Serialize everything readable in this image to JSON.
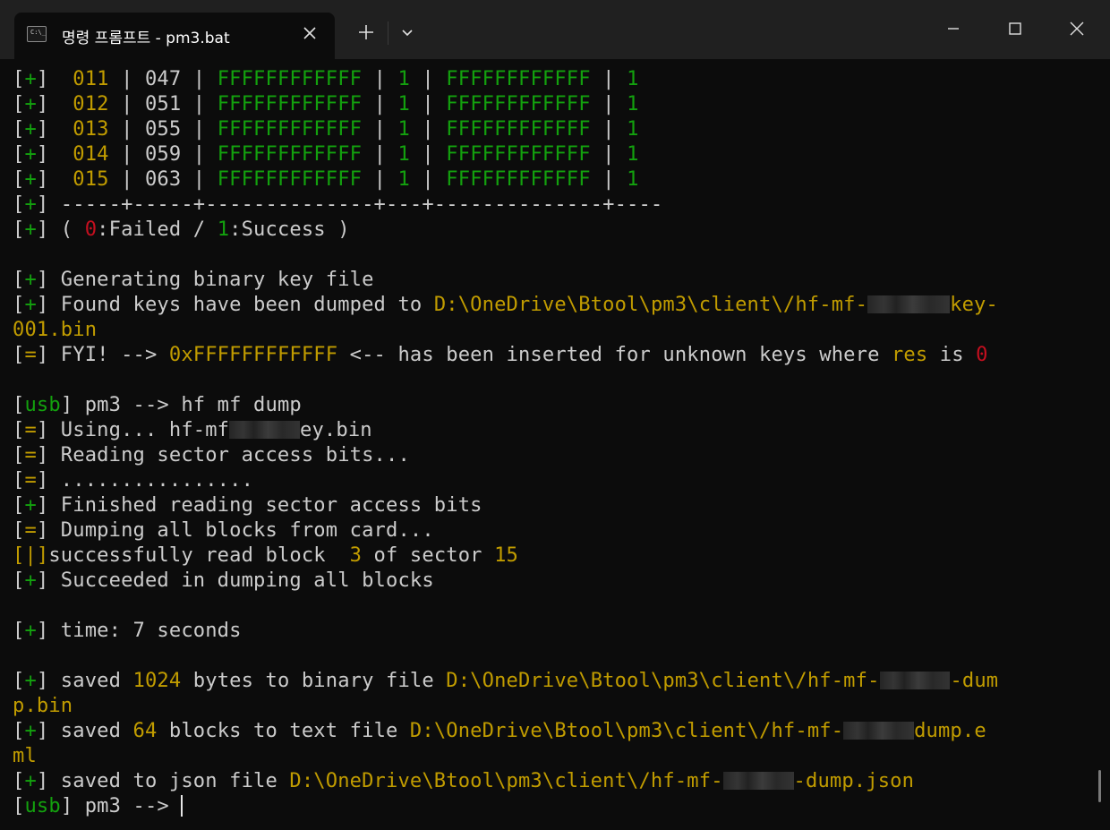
{
  "window": {
    "tab_title": "명령 프롬프트 - pm3.bat",
    "tab_icon_text": "C:\\_"
  },
  "terminal": {
    "lines": [
      [
        [
          "[",
          "w"
        ],
        [
          "+",
          "g"
        ],
        [
          "]  ",
          "w"
        ],
        [
          "011",
          "y"
        ],
        [
          " | 047 | ",
          "w"
        ],
        [
          "FFFFFFFFFFFF",
          "g"
        ],
        [
          " | ",
          "w"
        ],
        [
          "1",
          "g"
        ],
        [
          " | ",
          "w"
        ],
        [
          "FFFFFFFFFFFF",
          "g"
        ],
        [
          " | ",
          "w"
        ],
        [
          "1",
          "g"
        ]
      ],
      [
        [
          "[",
          "w"
        ],
        [
          "+",
          "g"
        ],
        [
          "]  ",
          "w"
        ],
        [
          "012",
          "y"
        ],
        [
          " | 051 | ",
          "w"
        ],
        [
          "FFFFFFFFFFFF",
          "g"
        ],
        [
          " | ",
          "w"
        ],
        [
          "1",
          "g"
        ],
        [
          " | ",
          "w"
        ],
        [
          "FFFFFFFFFFFF",
          "g"
        ],
        [
          " | ",
          "w"
        ],
        [
          "1",
          "g"
        ]
      ],
      [
        [
          "[",
          "w"
        ],
        [
          "+",
          "g"
        ],
        [
          "]  ",
          "w"
        ],
        [
          "013",
          "y"
        ],
        [
          " | 055 | ",
          "w"
        ],
        [
          "FFFFFFFFFFFF",
          "g"
        ],
        [
          " | ",
          "w"
        ],
        [
          "1",
          "g"
        ],
        [
          " | ",
          "w"
        ],
        [
          "FFFFFFFFFFFF",
          "g"
        ],
        [
          " | ",
          "w"
        ],
        [
          "1",
          "g"
        ]
      ],
      [
        [
          "[",
          "w"
        ],
        [
          "+",
          "g"
        ],
        [
          "]  ",
          "w"
        ],
        [
          "014",
          "y"
        ],
        [
          " | 059 | ",
          "w"
        ],
        [
          "FFFFFFFFFFFF",
          "g"
        ],
        [
          " | ",
          "w"
        ],
        [
          "1",
          "g"
        ],
        [
          " | ",
          "w"
        ],
        [
          "FFFFFFFFFFFF",
          "g"
        ],
        [
          " | ",
          "w"
        ],
        [
          "1",
          "g"
        ]
      ],
      [
        [
          "[",
          "w"
        ],
        [
          "+",
          "g"
        ],
        [
          "]  ",
          "w"
        ],
        [
          "015",
          "y"
        ],
        [
          " | 063 | ",
          "w"
        ],
        [
          "FFFFFFFFFFFF",
          "g"
        ],
        [
          " | ",
          "w"
        ],
        [
          "1",
          "g"
        ],
        [
          " | ",
          "w"
        ],
        [
          "FFFFFFFFFFFF",
          "g"
        ],
        [
          " | ",
          "w"
        ],
        [
          "1",
          "g"
        ]
      ],
      [
        [
          "[",
          "w"
        ],
        [
          "+",
          "g"
        ],
        [
          "] -----+-----+--------------+---+--------------+----",
          "w"
        ]
      ],
      [
        [
          "[",
          "w"
        ],
        [
          "+",
          "g"
        ],
        [
          "] ( ",
          "w"
        ],
        [
          "0",
          "r"
        ],
        [
          ":Failed / ",
          "w"
        ],
        [
          "1",
          "g"
        ],
        [
          ":Success )",
          "w"
        ]
      ],
      [],
      [
        [
          "[",
          "w"
        ],
        [
          "+",
          "g"
        ],
        [
          "] Generating binary key file",
          "w"
        ]
      ],
      [
        [
          "[",
          "w"
        ],
        [
          "+",
          "g"
        ],
        [
          "] Found keys have been dumped to ",
          "w"
        ],
        [
          "D:\\OneDrive\\Btool\\pm3\\client\\/hf-mf-",
          "y"
        ],
        [
          "blur:7",
          "b"
        ],
        [
          "key-",
          "y"
        ]
      ],
      [
        [
          "001.bin",
          "y"
        ]
      ],
      [
        [
          "[",
          "w"
        ],
        [
          "=",
          "y"
        ],
        [
          "] FYI! --> ",
          "w"
        ],
        [
          "0xFFFFFFFFFFFF",
          "y"
        ],
        [
          " <-- has been inserted for unknown keys where ",
          "w"
        ],
        [
          "res",
          "y"
        ],
        [
          " is ",
          "w"
        ],
        [
          "0",
          "r"
        ]
      ],
      [],
      [
        [
          "[",
          "w"
        ],
        [
          "usb",
          "g"
        ],
        [
          "] pm3 --> hf mf dump",
          "w"
        ]
      ],
      [
        [
          "[",
          "w"
        ],
        [
          "=",
          "y"
        ],
        [
          "] Using... hf-mf",
          "w"
        ],
        [
          "blur:6",
          "b"
        ],
        [
          "ey.bin",
          "w"
        ]
      ],
      [
        [
          "[",
          "w"
        ],
        [
          "=",
          "y"
        ],
        [
          "] Reading sector access bits...",
          "w"
        ]
      ],
      [
        [
          "[",
          "w"
        ],
        [
          "=",
          "y"
        ],
        [
          "] ................",
          "w"
        ]
      ],
      [
        [
          "[",
          "w"
        ],
        [
          "+",
          "g"
        ],
        [
          "] Finished reading sector access bits",
          "w"
        ]
      ],
      [
        [
          "[",
          "w"
        ],
        [
          "=",
          "y"
        ],
        [
          "] Dumping all blocks from card...",
          "w"
        ]
      ],
      [
        [
          "[|]",
          "y"
        ],
        [
          "successfully read block  ",
          "w"
        ],
        [
          "3",
          "y"
        ],
        [
          " of sector ",
          "w"
        ],
        [
          "15",
          "y"
        ]
      ],
      [
        [
          "[",
          "w"
        ],
        [
          "+",
          "g"
        ],
        [
          "] Succeeded in dumping all blocks",
          "w"
        ]
      ],
      [],
      [
        [
          "[",
          "w"
        ],
        [
          "+",
          "g"
        ],
        [
          "] time: 7 seconds",
          "w"
        ]
      ],
      [],
      [
        [
          "[",
          "w"
        ],
        [
          "+",
          "g"
        ],
        [
          "] saved ",
          "w"
        ],
        [
          "1024",
          "y"
        ],
        [
          " bytes to binary file ",
          "w"
        ],
        [
          "D:\\OneDrive\\Btool\\pm3\\client\\/hf-mf-",
          "y"
        ],
        [
          "blur:6",
          "b"
        ],
        [
          "-dum",
          "y"
        ]
      ],
      [
        [
          "p.bin",
          "y"
        ]
      ],
      [
        [
          "[",
          "w"
        ],
        [
          "+",
          "g"
        ],
        [
          "] saved ",
          "w"
        ],
        [
          "64",
          "y"
        ],
        [
          " blocks to text file ",
          "w"
        ],
        [
          "D:\\OneDrive\\Btool\\pm3\\client\\/hf-mf-",
          "y"
        ],
        [
          "blur:6",
          "b"
        ],
        [
          "dump.e",
          "y"
        ]
      ],
      [
        [
          "ml",
          "y"
        ]
      ],
      [
        [
          "[",
          "w"
        ],
        [
          "+",
          "g"
        ],
        [
          "] saved to json file ",
          "w"
        ],
        [
          "D:\\OneDrive\\Btool\\pm3\\client\\/hf-mf-",
          "y"
        ],
        [
          "blur:6",
          "b"
        ],
        [
          "-dump.json",
          "y"
        ]
      ],
      [
        [
          "[",
          "w"
        ],
        [
          "usb",
          "g"
        ],
        [
          "] pm3 --> ",
          "w"
        ],
        [
          "",
          "cursor"
        ]
      ]
    ]
  }
}
